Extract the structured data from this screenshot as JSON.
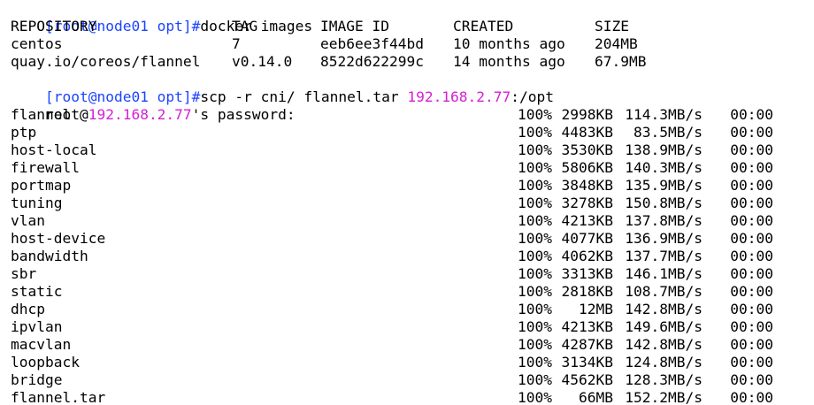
{
  "colors": {
    "background": "#ffffff",
    "text": "#000000",
    "prompt": "#1c44ff",
    "host_highlight": "#d420d4"
  },
  "terminal": {
    "cmd1": {
      "prompt": "[root@node01 opt]#",
      "command": "docker images"
    },
    "images_table": {
      "headers": [
        "REPOSITORY",
        "TAG",
        "IMAGE ID",
        "CREATED",
        "SIZE"
      ],
      "rows": [
        [
          "centos",
          "7",
          "eeb6ee3f44bd",
          "10 months ago",
          "204MB"
        ],
        [
          "quay.io/coreos/flannel",
          "v0.14.0",
          "8522d622299c",
          "14 months ago",
          "67.9MB"
        ]
      ]
    },
    "cmd2": {
      "prompt": "[root@node01 opt]#",
      "command_pre": "scp -r cni/ flannel.tar ",
      "host": "192.168.2.77",
      "command_post": ":/opt"
    },
    "password": {
      "pre": "root@",
      "host": "192.168.2.77",
      "post": "'s password:"
    },
    "transfers": [
      {
        "file": "flannel",
        "pct": "100%",
        "size": "2998KB",
        "rate": "114.3MB/s",
        "time": "00:00"
      },
      {
        "file": "ptp",
        "pct": "100%",
        "size": "4483KB",
        "rate": "83.5MB/s",
        "time": "00:00"
      },
      {
        "file": "host-local",
        "pct": "100%",
        "size": "3530KB",
        "rate": "138.9MB/s",
        "time": "00:00"
      },
      {
        "file": "firewall",
        "pct": "100%",
        "size": "5806KB",
        "rate": "140.3MB/s",
        "time": "00:00"
      },
      {
        "file": "portmap",
        "pct": "100%",
        "size": "3848KB",
        "rate": "135.9MB/s",
        "time": "00:00"
      },
      {
        "file": "tuning",
        "pct": "100%",
        "size": "3278KB",
        "rate": "150.8MB/s",
        "time": "00:00"
      },
      {
        "file": "vlan",
        "pct": "100%",
        "size": "4213KB",
        "rate": "137.8MB/s",
        "time": "00:00"
      },
      {
        "file": "host-device",
        "pct": "100%",
        "size": "4077KB",
        "rate": "136.9MB/s",
        "time": "00:00"
      },
      {
        "file": "bandwidth",
        "pct": "100%",
        "size": "4062KB",
        "rate": "137.7MB/s",
        "time": "00:00"
      },
      {
        "file": "sbr",
        "pct": "100%",
        "size": "3313KB",
        "rate": "146.1MB/s",
        "time": "00:00"
      },
      {
        "file": "static",
        "pct": "100%",
        "size": "2818KB",
        "rate": "108.7MB/s",
        "time": "00:00"
      },
      {
        "file": "dhcp",
        "pct": "100%",
        "size": "12MB",
        "rate": "142.8MB/s",
        "time": "00:00"
      },
      {
        "file": "ipvlan",
        "pct": "100%",
        "size": "4213KB",
        "rate": "149.6MB/s",
        "time": "00:00"
      },
      {
        "file": "macvlan",
        "pct": "100%",
        "size": "4287KB",
        "rate": "142.8MB/s",
        "time": "00:00"
      },
      {
        "file": "loopback",
        "pct": "100%",
        "size": "3134KB",
        "rate": "124.8MB/s",
        "time": "00:00"
      },
      {
        "file": "bridge",
        "pct": "100%",
        "size": "4562KB",
        "rate": "128.3MB/s",
        "time": "00:00"
      },
      {
        "file": "flannel.tar",
        "pct": "100%",
        "size": "66MB",
        "rate": "152.2MB/s",
        "time": "00:00"
      }
    ]
  }
}
